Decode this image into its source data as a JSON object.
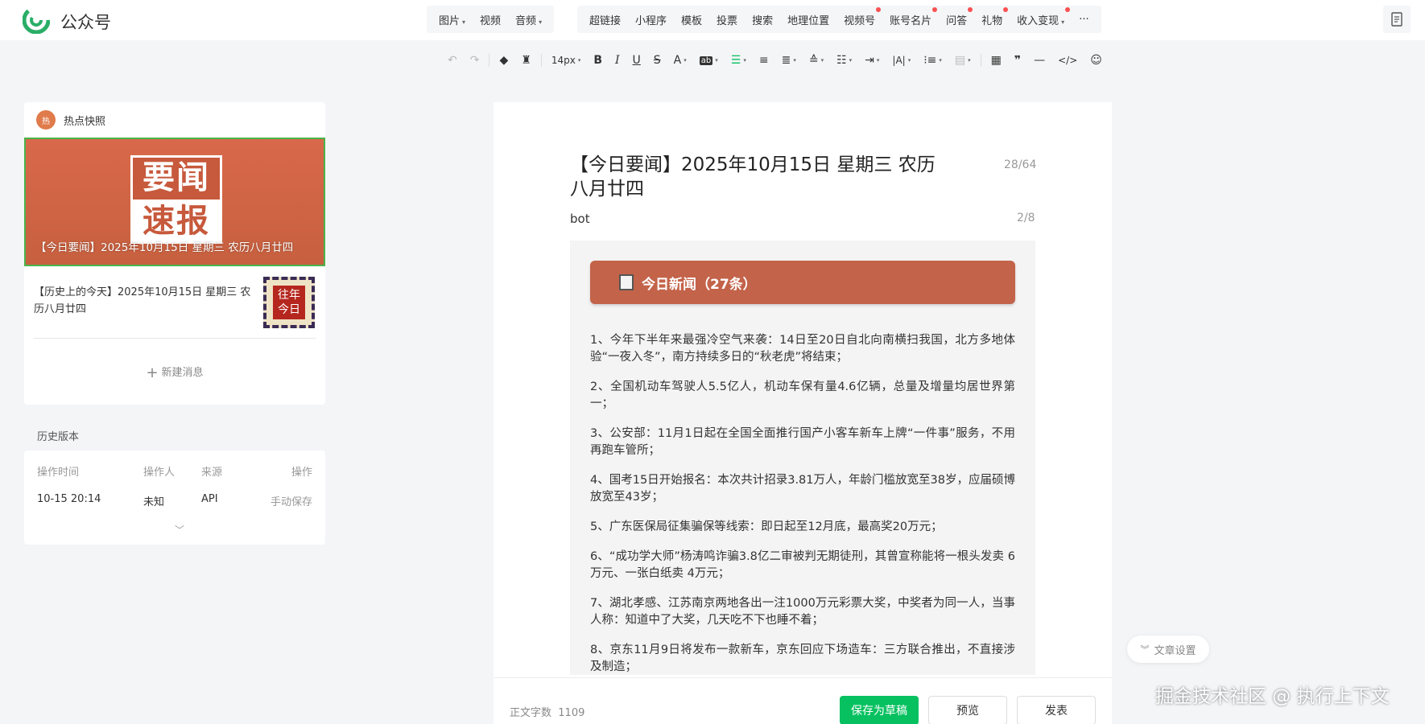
{
  "header": {
    "logo_text": "公众号",
    "insert_group1": [
      {
        "label": "图片",
        "caret": true
      },
      {
        "label": "视频",
        "caret": false
      },
      {
        "label": "音频",
        "caret": true
      }
    ],
    "insert_group2": [
      {
        "label": "超链接",
        "dot": false,
        "caret": false
      },
      {
        "label": "小程序",
        "dot": false,
        "caret": false
      },
      {
        "label": "模板",
        "dot": false,
        "caret": false
      },
      {
        "label": "投票",
        "dot": false,
        "caret": false
      },
      {
        "label": "搜索",
        "dot": false,
        "caret": false
      },
      {
        "label": "地理位置",
        "dot": false,
        "caret": false
      },
      {
        "label": "视频号",
        "dot": true,
        "caret": false
      },
      {
        "label": "账号名片",
        "dot": true,
        "caret": false
      },
      {
        "label": "问答",
        "dot": true,
        "caret": false
      },
      {
        "label": "礼物",
        "dot": true,
        "caret": false
      },
      {
        "label": "收入变现",
        "dot": true,
        "caret": true
      },
      {
        "label": "···",
        "dot": false,
        "caret": false
      }
    ]
  },
  "toolbar": {
    "font_size": "14px"
  },
  "sidebar": {
    "hot_title": "热点快照",
    "hot_icon_text": "热",
    "cover_badge_top": "要闻",
    "cover_badge_bottom": "速报",
    "cover_title": "【今日要闻】2025年10月15日 星期三 农历八月廿四",
    "article2_title": "【历史上的今天】2025年10月15日 星期三 农历八月廿四",
    "article2_thumb": "往年今日",
    "new_message": "新建消息"
  },
  "history": {
    "title": "历史版本",
    "headers": {
      "time": "操作时间",
      "user": "操作人",
      "source": "来源",
      "action": "操作"
    },
    "row": {
      "time": "10-15 20:14",
      "user": "未知",
      "source": "API",
      "action": "手动保存"
    }
  },
  "editor": {
    "title": "【今日要闻】2025年10月15日 星期三 农历八月廿四",
    "title_count": "28/64",
    "author": "bot",
    "author_count": "2/8",
    "news_header": "今日新闻（27条）",
    "news": [
      "1、今年下半年来最强冷空气来袭：14日至20日自北向南横扫我国，北方多地体验“一夜入冬”，南方持续多日的“秋老虎”将结束；",
      "2、全国机动车驾驶人5.5亿人，机动车保有量4.6亿辆，总量及增量均居世界第一；",
      "3、公安部：11月1日起在全国全面推行国产小客车新车上牌“一件事”服务，不用再跑车管所；",
      "4、国考15日开始报名：本次共计招录3.81万人，年龄门槛放宽至38岁，应届硕博放宽至43岁；",
      "5、广东医保局征集骗保等线索：即日起至12月底，最高奖20万元；",
      "6、“成功学大师”杨涛鸣诈骗3.8亿二审被判无期徒刑，其曾宣称能将一根头发卖 6万元、一张白纸卖 4万元；",
      "7、湖北孝感、江苏南京两地各出一注1000万元彩票大奖，中奖者为同一人，当事人称：知道中了大奖，几天吃不下也睡不着；",
      "8、京东11月9日将发布一款新车，京东回应下场造车：三方联合推出，不直接涉及制造；"
    ]
  },
  "footer": {
    "word_count_label": "正文字数",
    "word_count": "1109",
    "save_draft": "保存为草稿",
    "preview": "预览",
    "publish": "发表"
  },
  "article_settings": "文章设置",
  "watermark": "掘金技术社区 @ 执行上下文",
  "colors": {
    "accent_green": "#07c160",
    "news_header": "#c3634a",
    "dot": "#fa5151"
  }
}
